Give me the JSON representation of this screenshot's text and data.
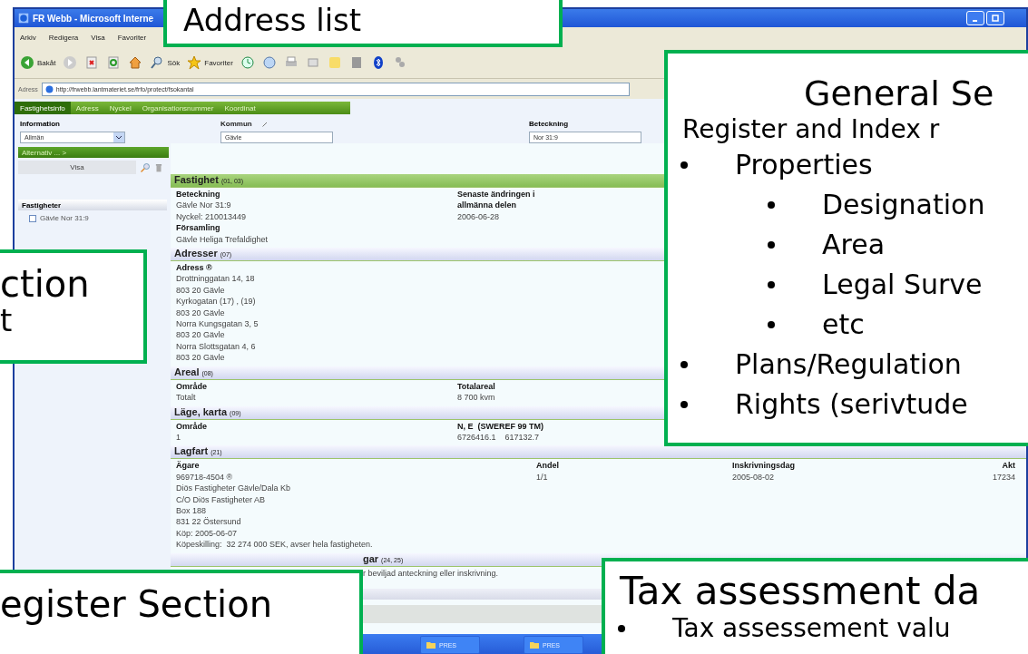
{
  "window": {
    "title": "FR Webb - Microsoft Interne"
  },
  "menu": [
    "Arkiv",
    "Redigera",
    "Visa",
    "Favoriter"
  ],
  "toolbar": {
    "back": "Bakåt",
    "search": "Sök",
    "favorites": "Favoriter"
  },
  "address_bar": {
    "label": "Adress",
    "url": "http://frwebb.lantmateriet.se/frfo/protect/fsokantal"
  },
  "nav_tabs": [
    {
      "label": "Fastighetsinfo",
      "selected": true
    },
    {
      "label": "Adress",
      "selected": false
    },
    {
      "label": "Nyckel",
      "selected": false
    },
    {
      "label": "Organisationsnummer",
      "selected": false
    },
    {
      "label": "Koordinat",
      "selected": false
    }
  ],
  "form": [
    {
      "label": "Information",
      "value": "Allmän",
      "kind": "select"
    },
    {
      "label": "Kommun",
      "value": "Gävle",
      "kind": "text"
    },
    {
      "label": "Beteckning",
      "value": "Nor 31:9",
      "kind": "text"
    }
  ],
  "sidebar": {
    "options_bar": "Alternativ ... >",
    "show_button": "Visa",
    "list_title": "Fastigheter",
    "items": [
      {
        "label": "Gävle Nor 31:9",
        "checked": false
      }
    ]
  },
  "sections": [
    {
      "title": "Fastighet",
      "code": "(01, 03)",
      "highlighted": true,
      "columns": [
        [
          {
            "kind": "label",
            "text": "Beteckning"
          },
          {
            "kind": "value",
            "text": "Gävle Nor 31:9"
          },
          {
            "kind": "value",
            "text": "Nyckel: 210013449"
          },
          {
            "kind": "label",
            "text": "Församling"
          },
          {
            "kind": "value",
            "text": "Gävle Heliga Trefaldighet"
          }
        ],
        [
          {
            "kind": "label",
            "text": "Senaste ändringen i"
          },
          {
            "kind": "label",
            "text": "allmänna delen"
          },
          {
            "kind": "value",
            "text": "2006-06-28"
          }
        ]
      ]
    },
    {
      "title": "Adresser",
      "code": "(07)",
      "highlighted": false,
      "columns": [
        [
          {
            "kind": "label",
            "text": "Adress ®"
          },
          {
            "kind": "value",
            "text": "Drottninggatan 14, 18"
          },
          {
            "kind": "value",
            "text": "803 20 Gävle"
          },
          {
            "kind": "value",
            "text": "Kyrkogatan (17) , (19)"
          },
          {
            "kind": "value",
            "text": "803 20 Gävle"
          },
          {
            "kind": "value",
            "text": "Norra Kungsgatan 3, 5"
          },
          {
            "kind": "value",
            "text": "803 20 Gävle"
          },
          {
            "kind": "value",
            "text": "Norra Slottsgatan 4, 6"
          },
          {
            "kind": "value",
            "text": "803 20 Gävle"
          }
        ]
      ]
    },
    {
      "title": "Areal",
      "code": "(08)",
      "highlighted": false,
      "columns": [
        [
          {
            "kind": "label",
            "text": "Område"
          },
          {
            "kind": "value",
            "text": "Totalt"
          }
        ],
        [
          {
            "kind": "label",
            "text": "Totalareal"
          },
          {
            "kind": "value",
            "text": "8 700 kvm"
          }
        ]
      ]
    },
    {
      "title": "Läge, karta",
      "code": "(09)",
      "highlighted": false,
      "columns": [
        [
          {
            "kind": "label",
            "text": "Område"
          },
          {
            "kind": "value",
            "text": "1"
          }
        ],
        [
          {
            "kind": "label",
            "text": "N, E  (SWEREF 99 TM)"
          },
          {
            "kind": "value",
            "text": "6726416.1    617132.7"
          }
        ]
      ]
    },
    {
      "title": "Lagfart",
      "code": "(21)",
      "highlighted": false,
      "columns": [
        [
          {
            "kind": "label",
            "text": "Ägare"
          },
          {
            "kind": "value",
            "text": "969718-4504 ®"
          },
          {
            "kind": "value",
            "text": "Diös Fastigheter Gävle/Dala Kb"
          },
          {
            "kind": "value",
            "text": "C/O Diös Fastigheter AB"
          },
          {
            "kind": "value",
            "text": "Box 188"
          },
          {
            "kind": "value",
            "text": "831 22 Östersund"
          },
          {
            "kind": "value",
            "text": "Köp: 2005-06-07"
          },
          {
            "kind": "value",
            "text": "Köpeskilling:  32 274 000 SEK, avser hela fastigheten."
          }
        ],
        [
          {
            "kind": "label",
            "text": "Andel"
          },
          {
            "kind": "value",
            "text": "1/1"
          }
        ],
        [
          {
            "kind": "label",
            "text": "Inskrivningsdag"
          },
          {
            "kind": "value",
            "text": "2005-08-02"
          }
        ],
        [
          {
            "kind": "label",
            "text": "Akt"
          },
          {
            "kind": "value",
            "text": "17234"
          }
        ]
      ]
    }
  ],
  "partial_section": {
    "title": "gar",
    "code": "(24, 25)",
    "text": "r beviljad anteckning eller inskrivning."
  },
  "taskbar": [
    "PRES",
    "PRES"
  ],
  "callouts": [
    {
      "title": "Address list"
    },
    {
      "title": "ction",
      "lines": [
        "t"
      ]
    },
    {
      "title": "General Se",
      "subtitle": "Register and Index r",
      "bullets": [
        {
          "text": "Properties",
          "children": [
            {
              "text": "Designation"
            },
            {
              "text": "Area"
            },
            {
              "text": "Legal Surve"
            },
            {
              "text": "etc"
            }
          ]
        },
        {
          "text": "Plans/Regulation"
        },
        {
          "text": "Rights (serivtude"
        }
      ]
    },
    {
      "title": "egister Section"
    },
    {
      "title": "Tax assessment da",
      "bullets": [
        {
          "text": "Tax assessement valu"
        }
      ]
    }
  ]
}
